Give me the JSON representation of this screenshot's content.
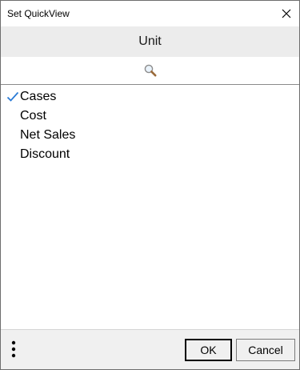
{
  "window": {
    "title": "Set QuickView"
  },
  "header": {
    "title": "Unit"
  },
  "search": {
    "icon": "search-icon"
  },
  "list": {
    "items": [
      {
        "label": "Cases",
        "checked": true
      },
      {
        "label": "Cost",
        "checked": false
      },
      {
        "label": "Net Sales",
        "checked": false
      },
      {
        "label": "Discount",
        "checked": false
      }
    ]
  },
  "footer": {
    "more_icon": "more-vertical-icon",
    "ok_label": "OK",
    "cancel_label": "Cancel"
  },
  "colors": {
    "check": "#2b7bd6",
    "header_bg": "#ececec",
    "footer_bg": "#f0f0f0"
  }
}
